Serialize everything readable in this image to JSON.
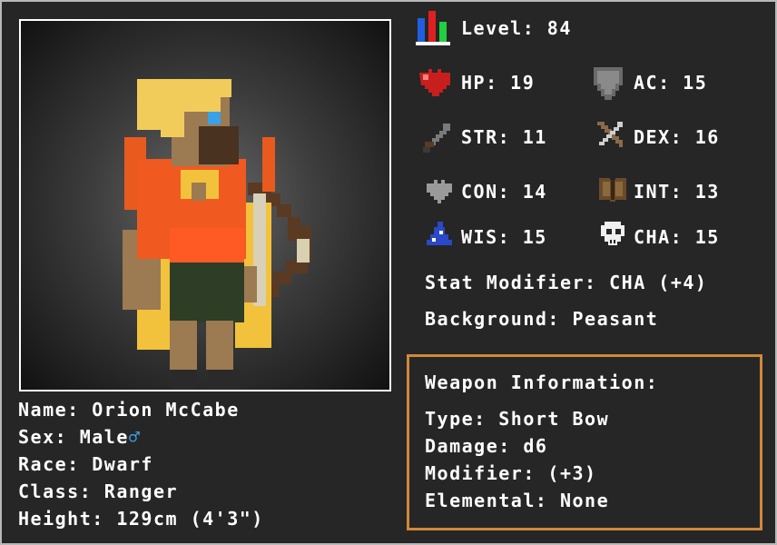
{
  "character": {
    "name_label": "Name:",
    "name": "Orion McCabe",
    "sex_label": "Sex:",
    "sex": "Male",
    "sex_symbol": "♂",
    "race_label": "Race:",
    "race": "Dwarf",
    "class_label": "Class:",
    "class": "Ranger",
    "height_label": "Height:",
    "height": "129cm (4'3\")"
  },
  "level": {
    "label": "Level:",
    "value": "84"
  },
  "stats": {
    "hp": {
      "label": "HP:",
      "value": "19",
      "icon": "heart-icon"
    },
    "ac": {
      "label": "AC:",
      "value": "15",
      "icon": "shield-icon"
    },
    "str": {
      "label": "STR:",
      "value": "11",
      "icon": "sword-icon"
    },
    "dex": {
      "label": "DEX:",
      "value": "16",
      "icon": "bow-icon"
    },
    "con": {
      "label": "CON:",
      "value": "14",
      "icon": "grey-heart-icon"
    },
    "int": {
      "label": "INT:",
      "value": "13",
      "icon": "book-icon"
    },
    "wis": {
      "label": "WIS:",
      "value": "15",
      "icon": "wizard-hat-icon"
    },
    "cha": {
      "label": "CHA:",
      "value": "15",
      "icon": "skull-icon"
    }
  },
  "stat_modifier": {
    "label": "Stat Modifier:",
    "value": "CHA (+4)"
  },
  "background": {
    "label": "Background:",
    "value": "Peasant"
  },
  "weapon": {
    "title": "Weapon Information:",
    "type_label": "Type:",
    "type": "Short Bow",
    "damage_label": "Damage:",
    "damage": "d6",
    "modifier_label": "Modifier:",
    "modifier": "(+3)",
    "elemental_label": "Elemental:",
    "elemental": "None"
  },
  "colors": {
    "panel": "#262626",
    "frame": "#b8b8b8",
    "weapon_border": "#d0883a",
    "male_symbol": "#3aa0e8"
  }
}
